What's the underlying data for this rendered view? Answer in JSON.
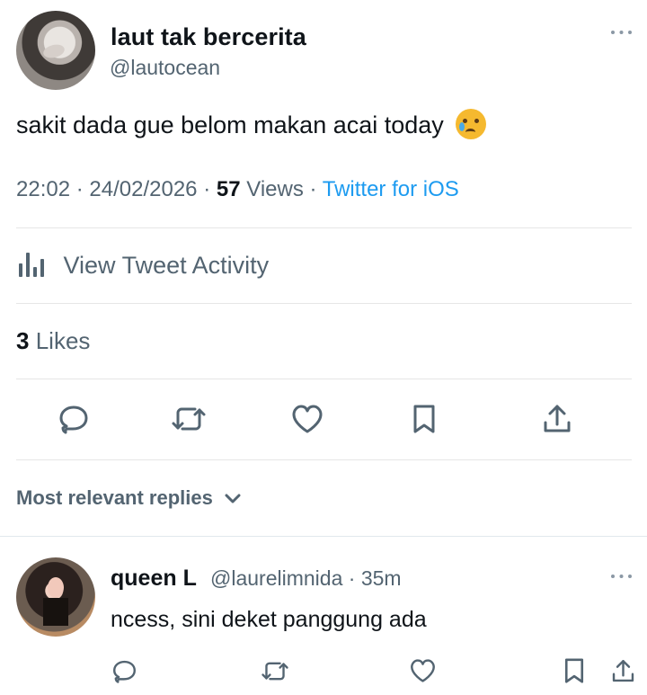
{
  "author": {
    "display_name": "laut tak bercerita",
    "handle": "@lautocean"
  },
  "tweet": {
    "text": "sakit dada gue belom makan acai today",
    "emoji": "crying-face",
    "time": "22:02",
    "date": "24/02/2026",
    "views_count": "57",
    "views_label": "Views",
    "client": "Twitter for iOS"
  },
  "activity": {
    "label": "View Tweet Activity"
  },
  "likes": {
    "count": "3",
    "label": "Likes"
  },
  "sort": {
    "label": "Most relevant replies"
  },
  "reply": {
    "display_name": "queen L",
    "handle": "@laurelimnida",
    "time": "35m",
    "text": "ncess, sini deket panggung ada"
  },
  "colors": {
    "text": "#0f1419",
    "secondary": "#536471",
    "link": "#1d9bf0",
    "divider": "#e6e6e6"
  },
  "icons": {
    "more": "more-horizontal",
    "activity": "bar-chart",
    "reply": "speech-bubble",
    "retweet": "retweet-arrows",
    "like": "heart",
    "bookmark": "bookmark",
    "share": "share-upload",
    "dropdown": "chevron-down"
  }
}
